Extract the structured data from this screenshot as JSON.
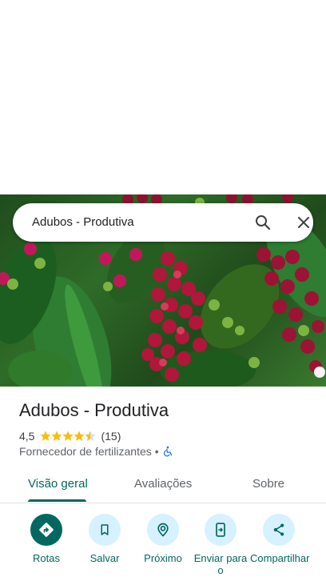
{
  "search": {
    "query": "Adubos - Produtiva"
  },
  "place": {
    "name": "Adubos - Produtiva",
    "rating": "4,5",
    "rating_value": 4.5,
    "review_count": "(15)",
    "category": "Fornecedor de fertilizantes",
    "separator": "•"
  },
  "tabs": [
    {
      "label": "Visão geral",
      "active": true
    },
    {
      "label": "Avaliações",
      "active": false
    },
    {
      "label": "Sobre",
      "active": false
    }
  ],
  "actions": [
    {
      "label": "Rotas",
      "icon": "directions-icon"
    },
    {
      "label": "Salvar",
      "icon": "bookmark-icon"
    },
    {
      "label": "Próximo",
      "icon": "nearby-icon"
    },
    {
      "label": "Enviar para o",
      "icon": "send-to-phone-icon"
    },
    {
      "label": "Compartilhar",
      "icon": "share-icon"
    }
  ],
  "colors": {
    "accent": "#00685e",
    "action_bg": "#d6f1ff",
    "star": "#fbbc04",
    "accessibility": "#1a73e8"
  }
}
